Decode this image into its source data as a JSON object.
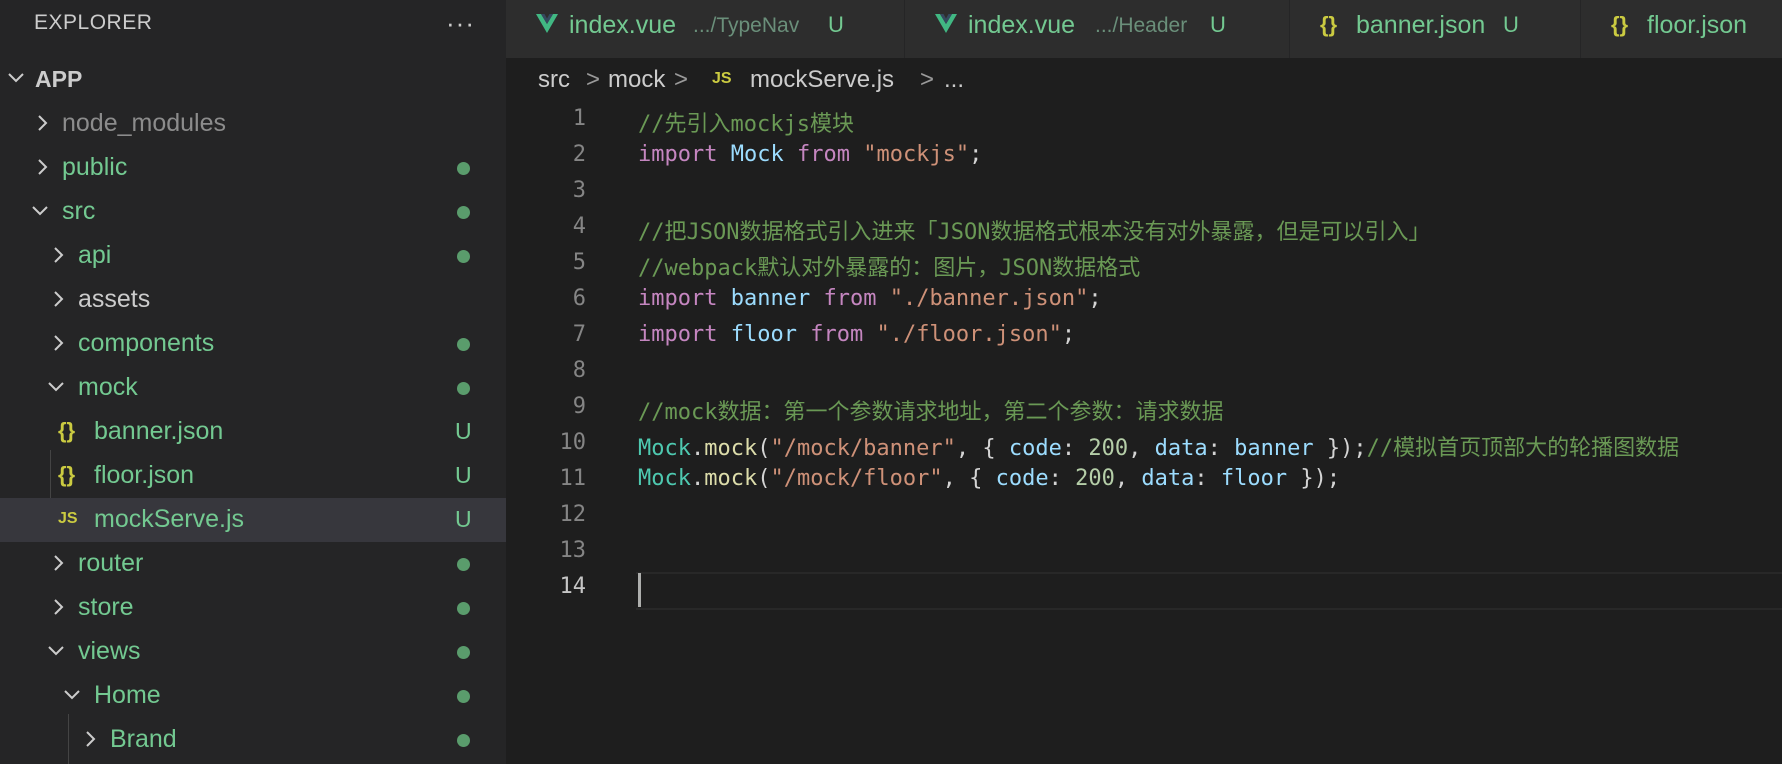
{
  "explorer": {
    "title": "EXPLORER",
    "more": "···",
    "root": "APP",
    "items": [
      {
        "label": "node_modules"
      },
      {
        "label": "public"
      },
      {
        "label": "src"
      },
      {
        "label": "api"
      },
      {
        "label": "assets"
      },
      {
        "label": "components"
      },
      {
        "label": "mock"
      },
      {
        "label": "banner.json",
        "badge": "U",
        "icon": "{}"
      },
      {
        "label": "floor.json",
        "badge": "U",
        "icon": "{}"
      },
      {
        "label": "mockServe.js",
        "badge": "U",
        "icon": "JS"
      },
      {
        "label": "router"
      },
      {
        "label": "store"
      },
      {
        "label": "views"
      },
      {
        "label": "Home"
      },
      {
        "label": "Brand"
      }
    ]
  },
  "tabs": [
    {
      "name": "index.vue",
      "desc": ".../TypeNav",
      "badge": "U"
    },
    {
      "name": "index.vue",
      "desc": ".../Header",
      "badge": "U"
    },
    {
      "name": "banner.json",
      "badge": "U",
      "icon": "{}"
    },
    {
      "name": "floor.json",
      "icon": "{}"
    }
  ],
  "breadcrumb": {
    "parts": [
      "src",
      "mock",
      "mockServe.js",
      "..."
    ],
    "file_icon": "JS",
    "sep": ">"
  },
  "code": {
    "line_numbers": [
      "1",
      "2",
      "3",
      "4",
      "5",
      "6",
      "7",
      "8",
      "9",
      "10",
      "11",
      "12",
      "13",
      "14"
    ],
    "l1_cmt": "//先引入mockjs模块",
    "l2_import": "import",
    "l2_var": "Mock",
    "l2_from": "from",
    "l2_str": "\"mockjs\"",
    "l2_end": ";",
    "l4_cmt": "//把JSON数据格式引入进来「JSON数据格式根本没有对外暴露，但是可以引入」",
    "l5_cmt": "//webpack默认对外暴露的：图片，JSON数据格式",
    "l6_import": "import",
    "l6_var": "banner",
    "l6_from": "from",
    "l6_str": "\"./banner.json\"",
    "l6_end": ";",
    "l7_import": "import",
    "l7_var": "floor",
    "l7_from": "from",
    "l7_str": "\"./floor.json\"",
    "l7_end": ";",
    "l9_cmt": "//mock数据：第一个参数请求地址，第二个参数：请求数据",
    "l10_cls": "Mock",
    "l10_dot": ".",
    "l10_fn": "mock",
    "l10_p1": "(",
    "l10_str": "\"/mock/banner\"",
    "l10_p2": ", { ",
    "l10_k1": "code",
    "l10_c1": ": ",
    "l10_num": "200",
    "l10_c2": ", ",
    "l10_k2": "data",
    "l10_c3": ": ",
    "l10_v": "banner",
    "l10_end": " });",
    "l10_cmt": "//模拟首页顶部大的轮播图数据",
    "l11_cls": "Mock",
    "l11_dot": ".",
    "l11_fn": "mock",
    "l11_p1": "(",
    "l11_str": "\"/mock/floor\"",
    "l11_p2": ", { ",
    "l11_k1": "code",
    "l11_c1": ": ",
    "l11_num": "200",
    "l11_c2": ", ",
    "l11_k2": "data",
    "l11_c3": ": ",
    "l11_v": "floor",
    "l11_end": " });"
  },
  "colors": {
    "git_untracked": "#73c991",
    "editor_bg": "#1e1e1e",
    "sidebar_bg": "#252526",
    "comment": "#6a9955",
    "keyword": "#c586c0",
    "string": "#ce9178"
  }
}
